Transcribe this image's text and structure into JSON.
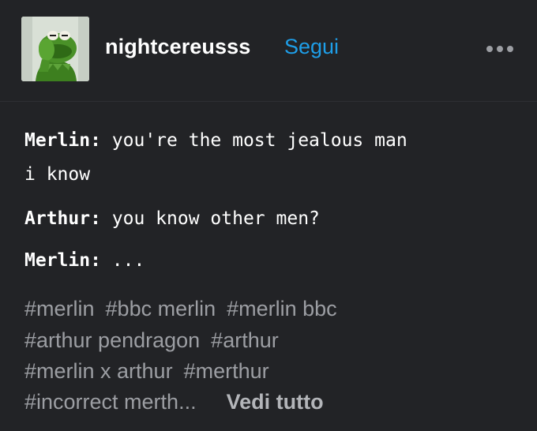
{
  "post": {
    "username": "nightcereusss",
    "follow_label": "Segui",
    "more_icon": "ellipsis-icon",
    "avatar_icon": "kermit-avatar"
  },
  "dialogue": [
    {
      "speaker": "Merlin:",
      "text": "you're the most jealous man"
    },
    {
      "continuation": "i know"
    },
    {
      "speaker": "Arthur:",
      "text": "you know other men?"
    },
    {
      "speaker": "Merlin:",
      "text": "..."
    }
  ],
  "tags": [
    "#merlin",
    "#bbc merlin",
    "#merlin bbc",
    "#arthur pendragon",
    "#arthur",
    "#merlin x arthur",
    "#merthur",
    "#incorrect merth..."
  ],
  "see_all_label": "Vedi tutto",
  "colors": {
    "background": "#222326",
    "accent": "#1e9ee8",
    "tag": "#9c9ea3"
  }
}
